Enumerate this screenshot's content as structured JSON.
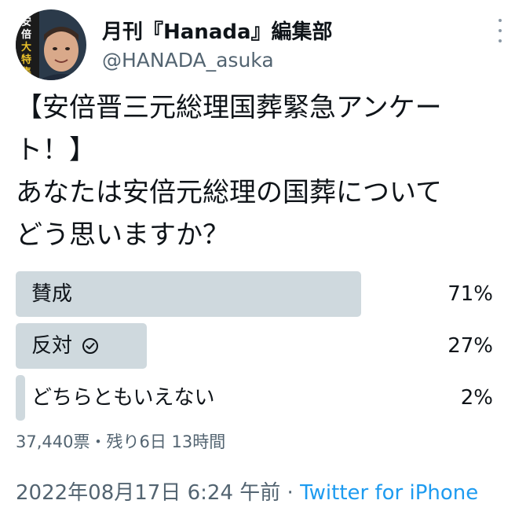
{
  "author": {
    "display_name": "月刊『Hanada』編集部",
    "handle": "@HANADA_asuka",
    "avatar_text": "安倍晋三総理 追悼大特集"
  },
  "tweet": {
    "lines": [
      "【安倍晋三元総理国葬緊急アンケー",
      "ト！】",
      "あなたは安倍元総理の国葬について",
      "どう思いますか？"
    ]
  },
  "poll": {
    "options": [
      {
        "label": "賛成",
        "percent_text": "71%",
        "fraction": 0.71,
        "selected": false
      },
      {
        "label": "反対",
        "percent_text": "27%",
        "fraction": 0.27,
        "selected": true
      },
      {
        "label": "どちらともいえない",
        "percent_text": "2%",
        "fraction": 0.02,
        "selected": false
      }
    ],
    "meta": "37,440票・残り6日 13時間"
  },
  "timestamp": {
    "datetime": "2022年08月17日 6:24 午前",
    "separator": "·",
    "source": "Twitter for iPhone"
  },
  "colors": {
    "bar": "#cfd9de",
    "link": "#1d9bf0",
    "secondary_text": "#536471"
  },
  "icons": {
    "more": "more-vertical-icon",
    "check": "check-circle-icon"
  }
}
